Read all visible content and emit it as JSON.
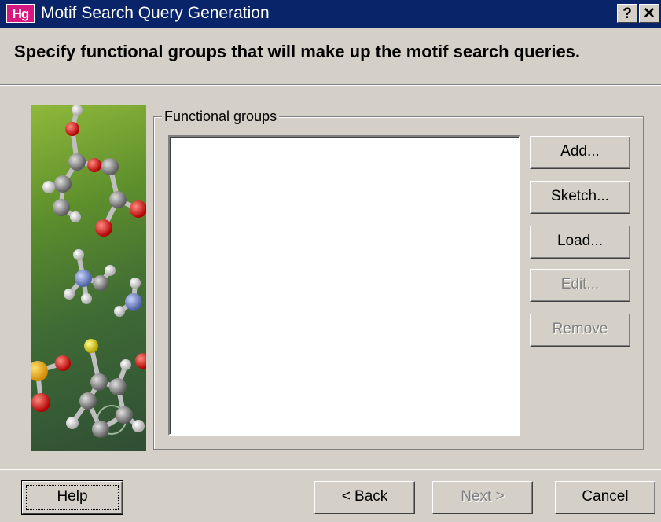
{
  "window": {
    "app_icon": "Hg",
    "title": "Motif Search Query Generation",
    "help_glyph": "?",
    "close_glyph": "✕"
  },
  "header": {
    "instruction": "Specify functional groups that will make up the motif search queries."
  },
  "functional_groups": {
    "label": "Functional groups",
    "items": []
  },
  "side_buttons": {
    "add": "Add...",
    "sketch": "Sketch...",
    "load": "Load...",
    "edit": "Edit...",
    "remove": "Remove"
  },
  "footer": {
    "help": "Help",
    "back": "< Back",
    "next": "Next >",
    "cancel": "Cancel"
  },
  "colors": {
    "titlebar": "#0a246a",
    "dialog_bg": "#d4d0c8",
    "app_icon_bg": "#d8167f",
    "disabled_text": "#808080"
  }
}
